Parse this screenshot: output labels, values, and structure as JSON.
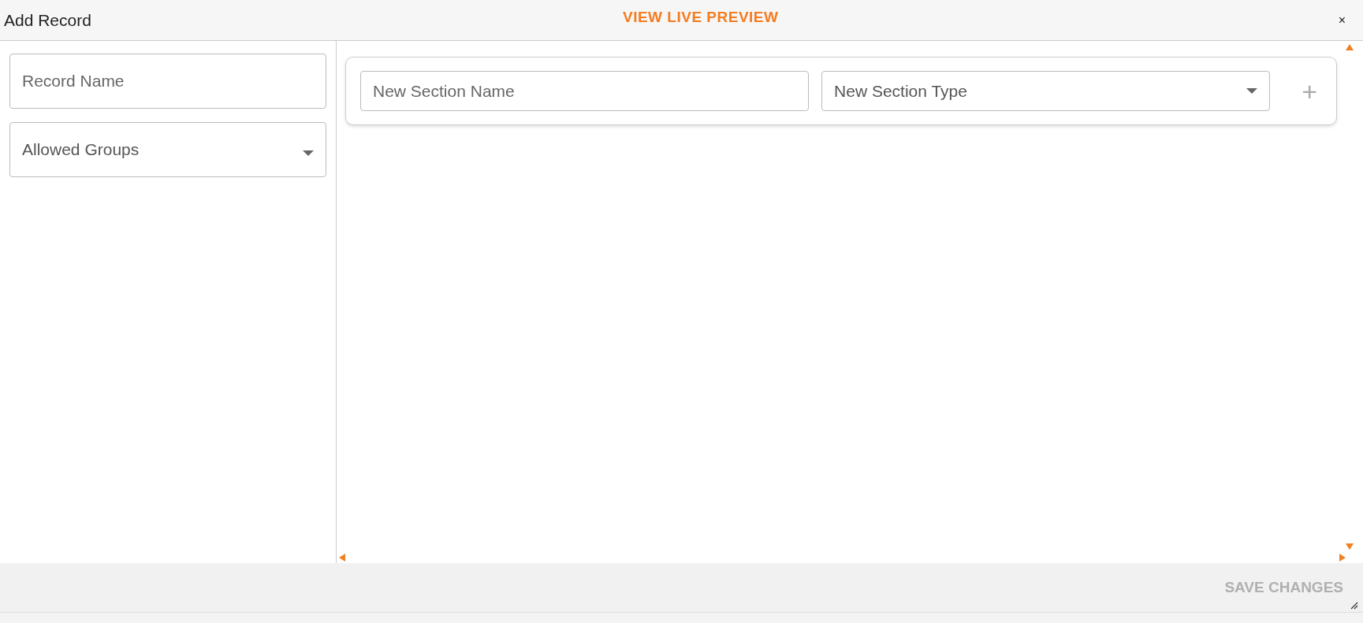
{
  "window": {
    "title": "Add Record",
    "preview_link": "VIEW LIVE PREVIEW",
    "close": "×"
  },
  "record_fields": [
    {
      "kind": "text",
      "placeholder": "Record Name"
    },
    {
      "kind": "dropdown",
      "placeholder": "Allowed Groups"
    }
  ],
  "new_section": {
    "name": {
      "placeholder": "New Section Name"
    },
    "type": {
      "placeholder": "New Section Type"
    },
    "add_button": "+"
  },
  "footer": {
    "save_button": {
      "label": "SAVE CHANGES",
      "disabled": true
    }
  }
}
